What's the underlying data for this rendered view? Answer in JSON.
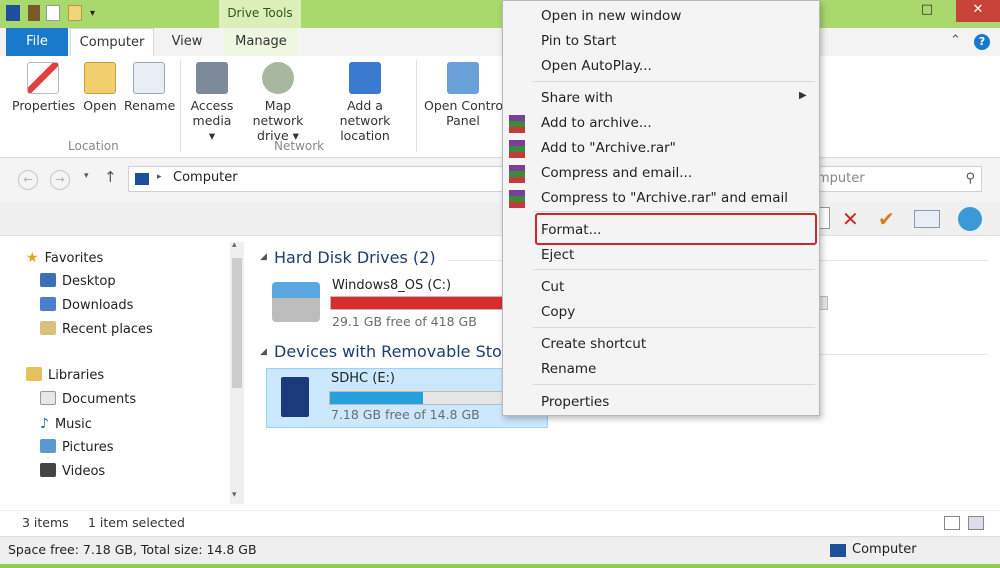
{
  "title_bar": {
    "contextual_tab": "Drive Tools"
  },
  "ribbon_tabs": {
    "file": "File",
    "computer": "Computer",
    "view": "View",
    "manage": "Manage"
  },
  "ribbon": {
    "location": {
      "label": "Location",
      "buttons": [
        "Properties",
        "Open",
        "Rename"
      ]
    },
    "network": {
      "label": "Network",
      "access_media_l1": "Access",
      "access_media_l2": "media ▾",
      "map_drive_l1": "Map network",
      "map_drive_l2": "drive ▾",
      "add_location_l1": "Add a network",
      "add_location_l2": "location"
    },
    "control_panel_l1": "Open Control",
    "control_panel_l2": "Panel"
  },
  "address": {
    "path": "Computer",
    "search_placeholder": "mputer"
  },
  "nav_pane": {
    "favorites": "Favorites",
    "desktop": "Desktop",
    "downloads": "Downloads",
    "recent": "Recent places",
    "libraries": "Libraries",
    "documents": "Documents",
    "music": "Music",
    "pictures": "Pictures",
    "videos": "Videos"
  },
  "content": {
    "hard_disk_title": "Hard Disk Drives (2)",
    "removable_title": "Devices with Removable Stora",
    "drive_c": {
      "name": "Windows8_OS (C:)",
      "free": "29.1 GB free of 418 GB",
      "used_fraction": 0.93,
      "bar_color": "#da2c2c"
    },
    "drive_e": {
      "name": "SDHC (E:)",
      "free": "7.18 GB free of 14.8 GB",
      "used_fraction": 0.52,
      "bar_color": "#26a0da"
    }
  },
  "status": {
    "items": "3 items",
    "selected": "1 item selected",
    "space": "Space free: 7.18 GB, Total size: 14.8 GB",
    "location": "Computer"
  },
  "context_menu": {
    "open_new_window": "Open in new window",
    "pin_to_start": "Pin to Start",
    "open_autoplay": "Open AutoPlay...",
    "share_with": "Share with",
    "add_to_archive": "Add to archive...",
    "add_to_archive_rar": "Add to \"Archive.rar\"",
    "compress_email": "Compress and email...",
    "compress_rar_email": "Compress to \"Archive.rar\" and email",
    "format": "Format...",
    "eject": "Eject",
    "cut": "Cut",
    "copy": "Copy",
    "create_shortcut": "Create shortcut",
    "rename": "Rename",
    "properties": "Properties"
  },
  "colors": {
    "titlebar_green": "#a9d96d",
    "file_tab_blue": "#1979ca",
    "highlight_red": "#c8282a",
    "selection_blue": "#cce8ff"
  }
}
